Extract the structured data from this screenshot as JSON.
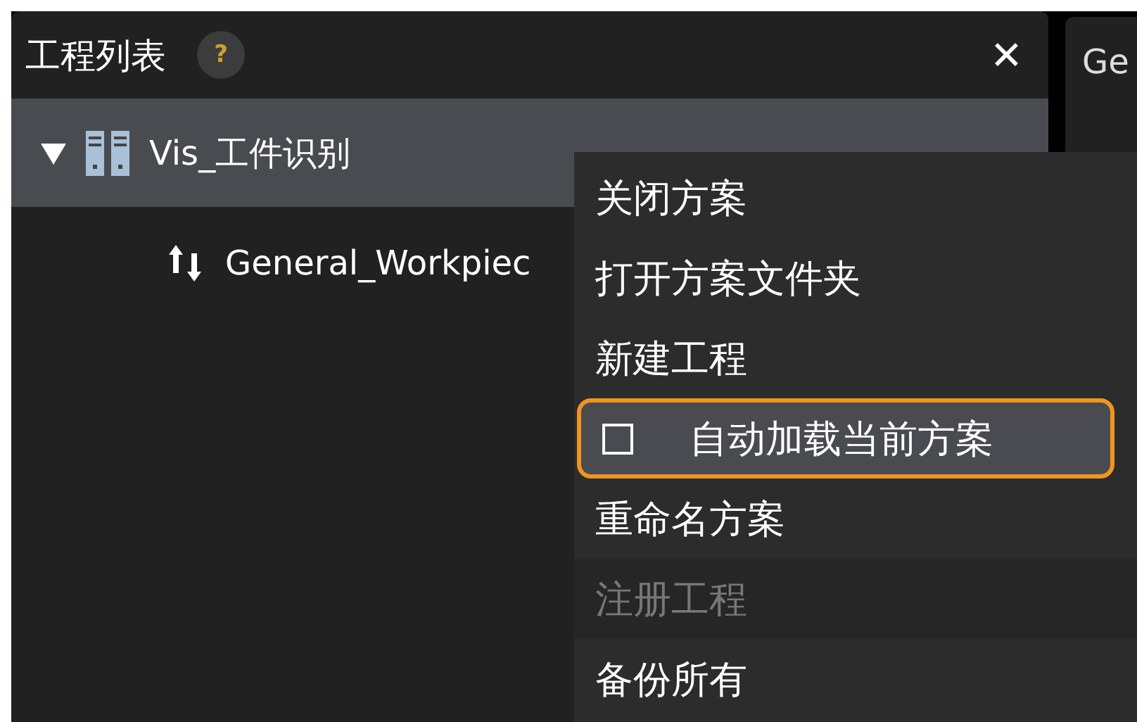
{
  "panel": {
    "title": "工程列表",
    "help": "?",
    "close": "✕"
  },
  "tree": [
    {
      "label": "Vis_工件识别",
      "expanded": true,
      "selected": true,
      "children": [
        {
          "label": "General_Workpiec",
          "selected": false
        }
      ]
    }
  ],
  "side_panel": {
    "tab": "Ge"
  },
  "context_menu": [
    {
      "kind": "action",
      "label": "关闭方案",
      "highlighted": false,
      "disabled": false
    },
    {
      "kind": "action",
      "label": "打开方案文件夹",
      "highlighted": false,
      "disabled": false
    },
    {
      "kind": "action",
      "label": "新建工程",
      "highlighted": false,
      "disabled": false
    },
    {
      "kind": "checkbox",
      "label": "自动加载当前方案",
      "checked": false,
      "highlighted": true,
      "disabled": false
    },
    {
      "kind": "action",
      "label": "重命名方案",
      "highlighted": false,
      "disabled": false
    },
    {
      "kind": "action",
      "label": "注册工程",
      "highlighted": false,
      "disabled": true
    },
    {
      "kind": "action",
      "label": "备份所有",
      "highlighted": false,
      "disabled": false
    }
  ]
}
